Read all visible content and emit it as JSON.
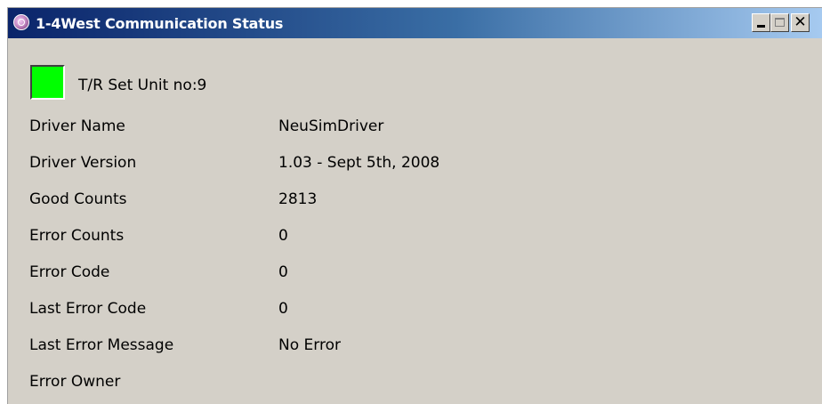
{
  "window": {
    "title": "1-4West Communication Status",
    "close_glyph": "✕"
  },
  "status": {
    "indicator_color": "#00ff00",
    "indicator_state": "connected",
    "unit_label": "T/R Set Unit no:9"
  },
  "fields": [
    {
      "label": "Driver Name",
      "value": "NeuSimDriver"
    },
    {
      "label": "Driver Version",
      "value": "1.03 - Sept 5th, 2008"
    },
    {
      "label": "Good Counts",
      "value": "2813"
    },
    {
      "label": "Error Counts",
      "value": "0"
    },
    {
      "label": "Error Code",
      "value": "0"
    },
    {
      "label": "Last Error Code",
      "value": "0"
    },
    {
      "label": "Last Error Message",
      "value": "No Error"
    },
    {
      "label": "Error Owner",
      "value": ""
    }
  ],
  "icons": {
    "app": "app-icon",
    "minimize": "minimize-icon",
    "maximize": "maximize-icon",
    "close": "close-icon"
  }
}
